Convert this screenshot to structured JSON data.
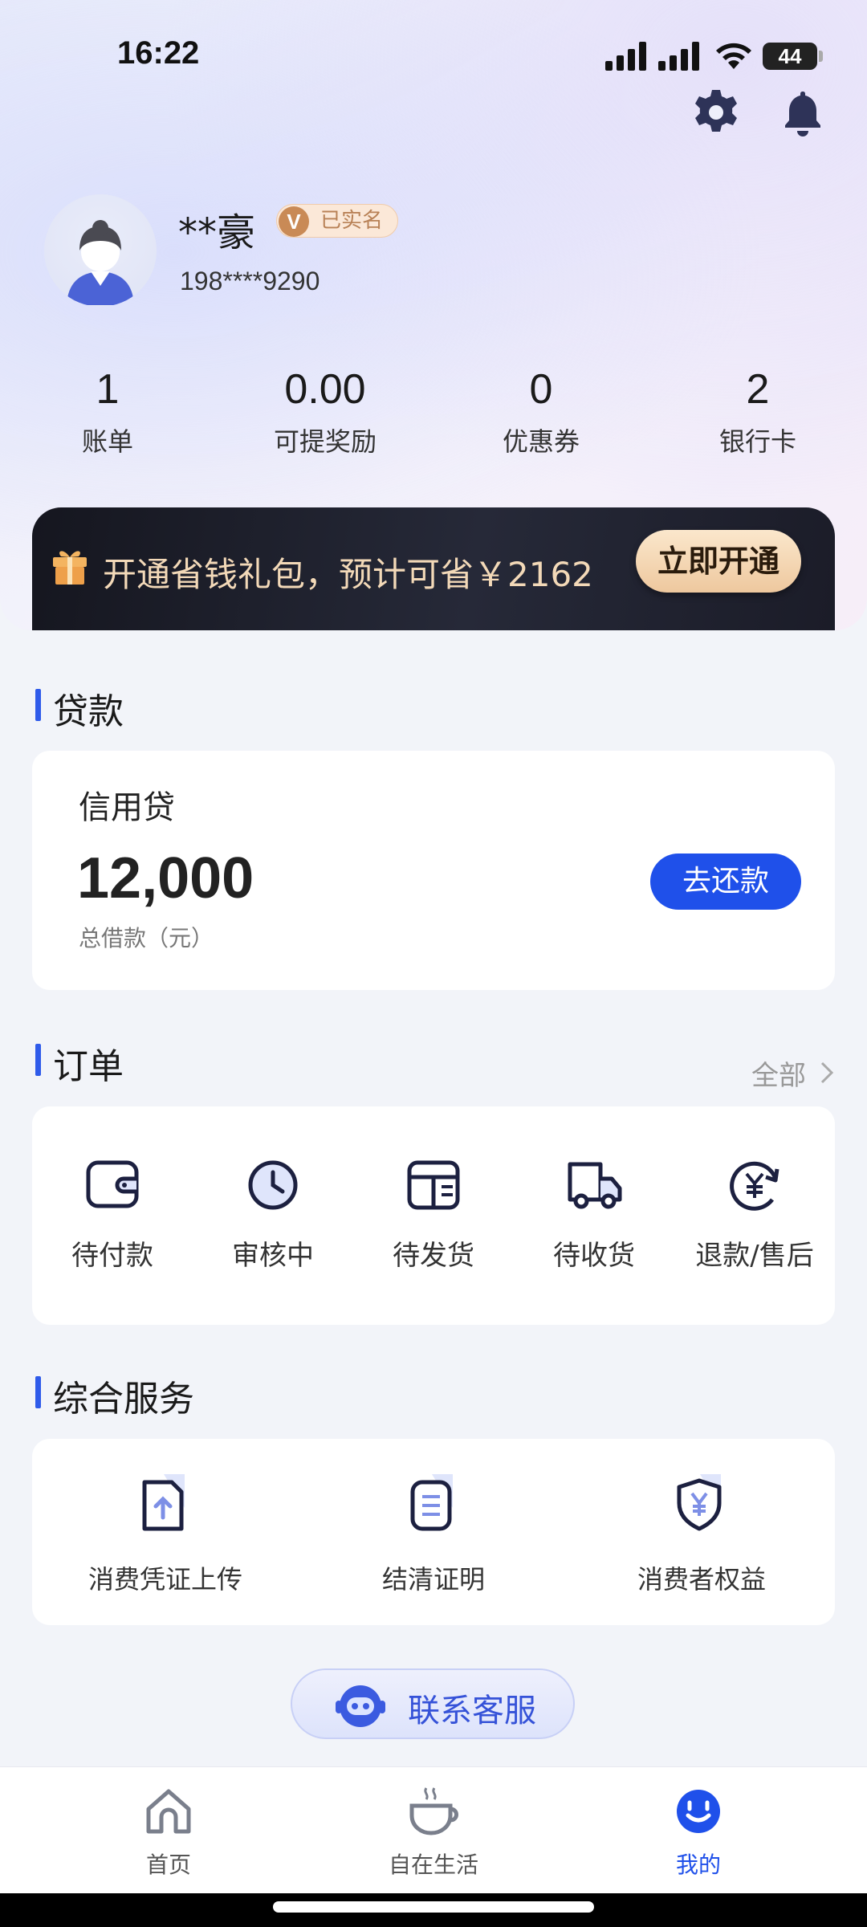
{
  "status_bar": {
    "time": "16:22",
    "battery": "44"
  },
  "header": {
    "settings_icon": "gear-icon",
    "notification_icon": "bell-icon"
  },
  "user": {
    "name": "**豪",
    "verified_label": "已实名",
    "verified_mark": "V",
    "phone": "198****9290"
  },
  "stats": [
    {
      "value": "1",
      "label": "账单"
    },
    {
      "value": "0.00",
      "label": "可提奖励"
    },
    {
      "value": "0",
      "label": "优惠券"
    },
    {
      "value": "2",
      "label": "银行卡"
    }
  ],
  "promo": {
    "text": "开通省钱礼包，预计可省￥2162",
    "button": "立即开通"
  },
  "loan": {
    "section_title": "贷款",
    "product": "信用贷",
    "amount": "12,000",
    "amount_label": "总借款（元）",
    "repay_button": "去还款"
  },
  "orders": {
    "section_title": "订单",
    "all_link": "全部",
    "items": [
      {
        "label": "待付款",
        "icon": "wallet-icon"
      },
      {
        "label": "审核中",
        "icon": "clock-icon"
      },
      {
        "label": "待发货",
        "icon": "package-icon"
      },
      {
        "label": "待收货",
        "icon": "truck-icon"
      },
      {
        "label": "退款/售后",
        "icon": "refund-icon"
      }
    ]
  },
  "services": {
    "section_title": "综合服务",
    "items": [
      {
        "label": "消费凭证上传",
        "icon": "upload-document-icon"
      },
      {
        "label": "结清证明",
        "icon": "certificate-icon"
      },
      {
        "label": "消费者权益",
        "icon": "shield-yuan-icon"
      }
    ]
  },
  "customer_service": {
    "label": "联系客服"
  },
  "tabbar": [
    {
      "label": "首页",
      "icon": "home-icon"
    },
    {
      "label": "自在生活",
      "icon": "coffee-icon"
    },
    {
      "label": "我的",
      "icon": "smiley-icon",
      "active": true
    }
  ],
  "colors": {
    "accent": "#1f50ea",
    "promo_bg": "#1b1c28",
    "promo_text": "#f3d9b8",
    "badge_bg": "#fbe8d8"
  }
}
